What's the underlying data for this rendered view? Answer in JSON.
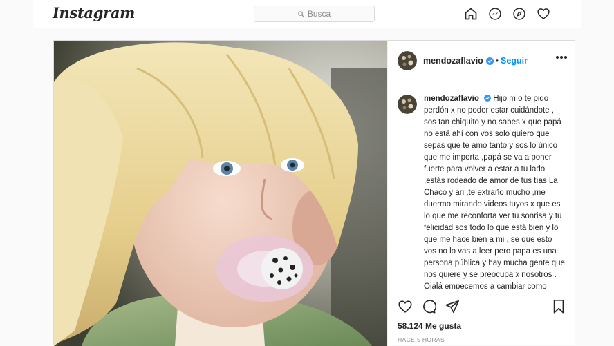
{
  "nav": {
    "logo": "Instagram",
    "search_placeholder": "Busca",
    "icons": [
      "home-icon",
      "messenger-icon",
      "explore-icon",
      "heart-icon"
    ]
  },
  "post": {
    "username": "mendozaflavio",
    "separator": "•",
    "follow_label": "Seguir",
    "caption_user": "mendozaflavio",
    "caption": "Hijo mío te pido perdón x no poder estar cuidándote , sos tan chiquito y no sabes x que papá no está ahí con vos solo quiero que sepas que te amo tanto y sos lo único que me importa ,papá se va a poner fuerte para volver a estar a tu lado ,estás rodeado de amor de tus tías La Chaco y ari ,te extraño mucho ,me duermo mirando videos tuyos x que es lo que me reconforta ver tu sonrisa y tu felicidad sos todo lo que está bien y lo que me hace bien a mi , se que esto vos no lo vas a leer pero papa es una persona pública y hay mucha gente que nos quiere y se preocupa x nosotros . Ojalá empecemos a cambiar como seres humanos y dejar de regocijarse con la desgracia ajena x",
    "likes": "58.124 Me gusta",
    "time": "HACE 5 HORAS"
  },
  "colors": {
    "accent": "#0095f6",
    "verified": "#3897f0",
    "text": "#262626",
    "muted": "#8e8e8e",
    "border": "#dbdbdb"
  }
}
